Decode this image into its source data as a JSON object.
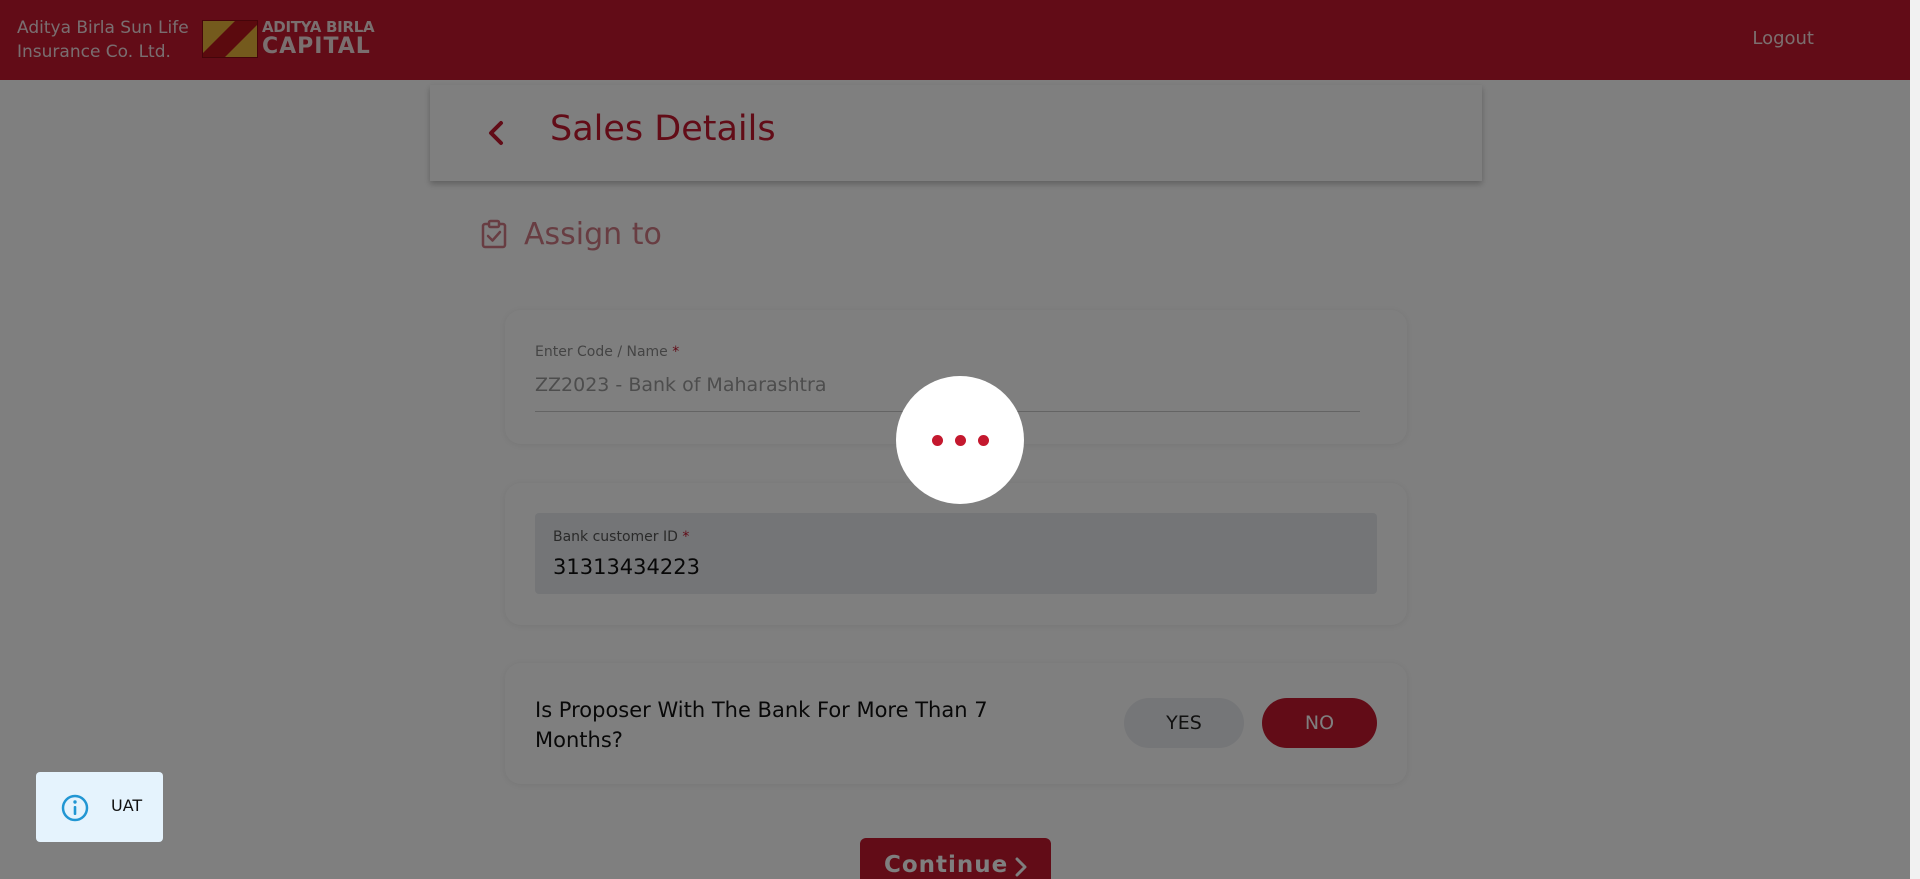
{
  "header": {
    "brand_line1": "Aditya Birla Sun Life",
    "brand_line2": "Insurance Co. Ltd.",
    "logo_top": "ADITYA BIRLA",
    "logo_bottom": "CAPITAL",
    "logout_label": "Logout"
  },
  "page": {
    "title": "Sales Details",
    "back_icon": "chevron-left-icon"
  },
  "section": {
    "icon": "clipboard-check-icon",
    "title": "Assign to"
  },
  "code_field": {
    "label": "Enter Code / Name",
    "required_mark": "*",
    "value": "ZZ2023 - Bank of Maharashtra"
  },
  "bank_field": {
    "label": "Bank customer ID",
    "required_mark": "*",
    "value": "31313434223"
  },
  "proposer_question": {
    "text": "Is Proposer With The Bank For More Than 7 Months?",
    "yes_label": "YES",
    "no_label": "NO",
    "selected": "NO"
  },
  "continue_label": "Continue",
  "env_badge": {
    "icon": "info-icon",
    "label": "UAT"
  },
  "colors": {
    "brand": "#c4182e",
    "overlay": "rgba(0,0,0,0.5)",
    "badge_bg": "#e5f3fd"
  }
}
